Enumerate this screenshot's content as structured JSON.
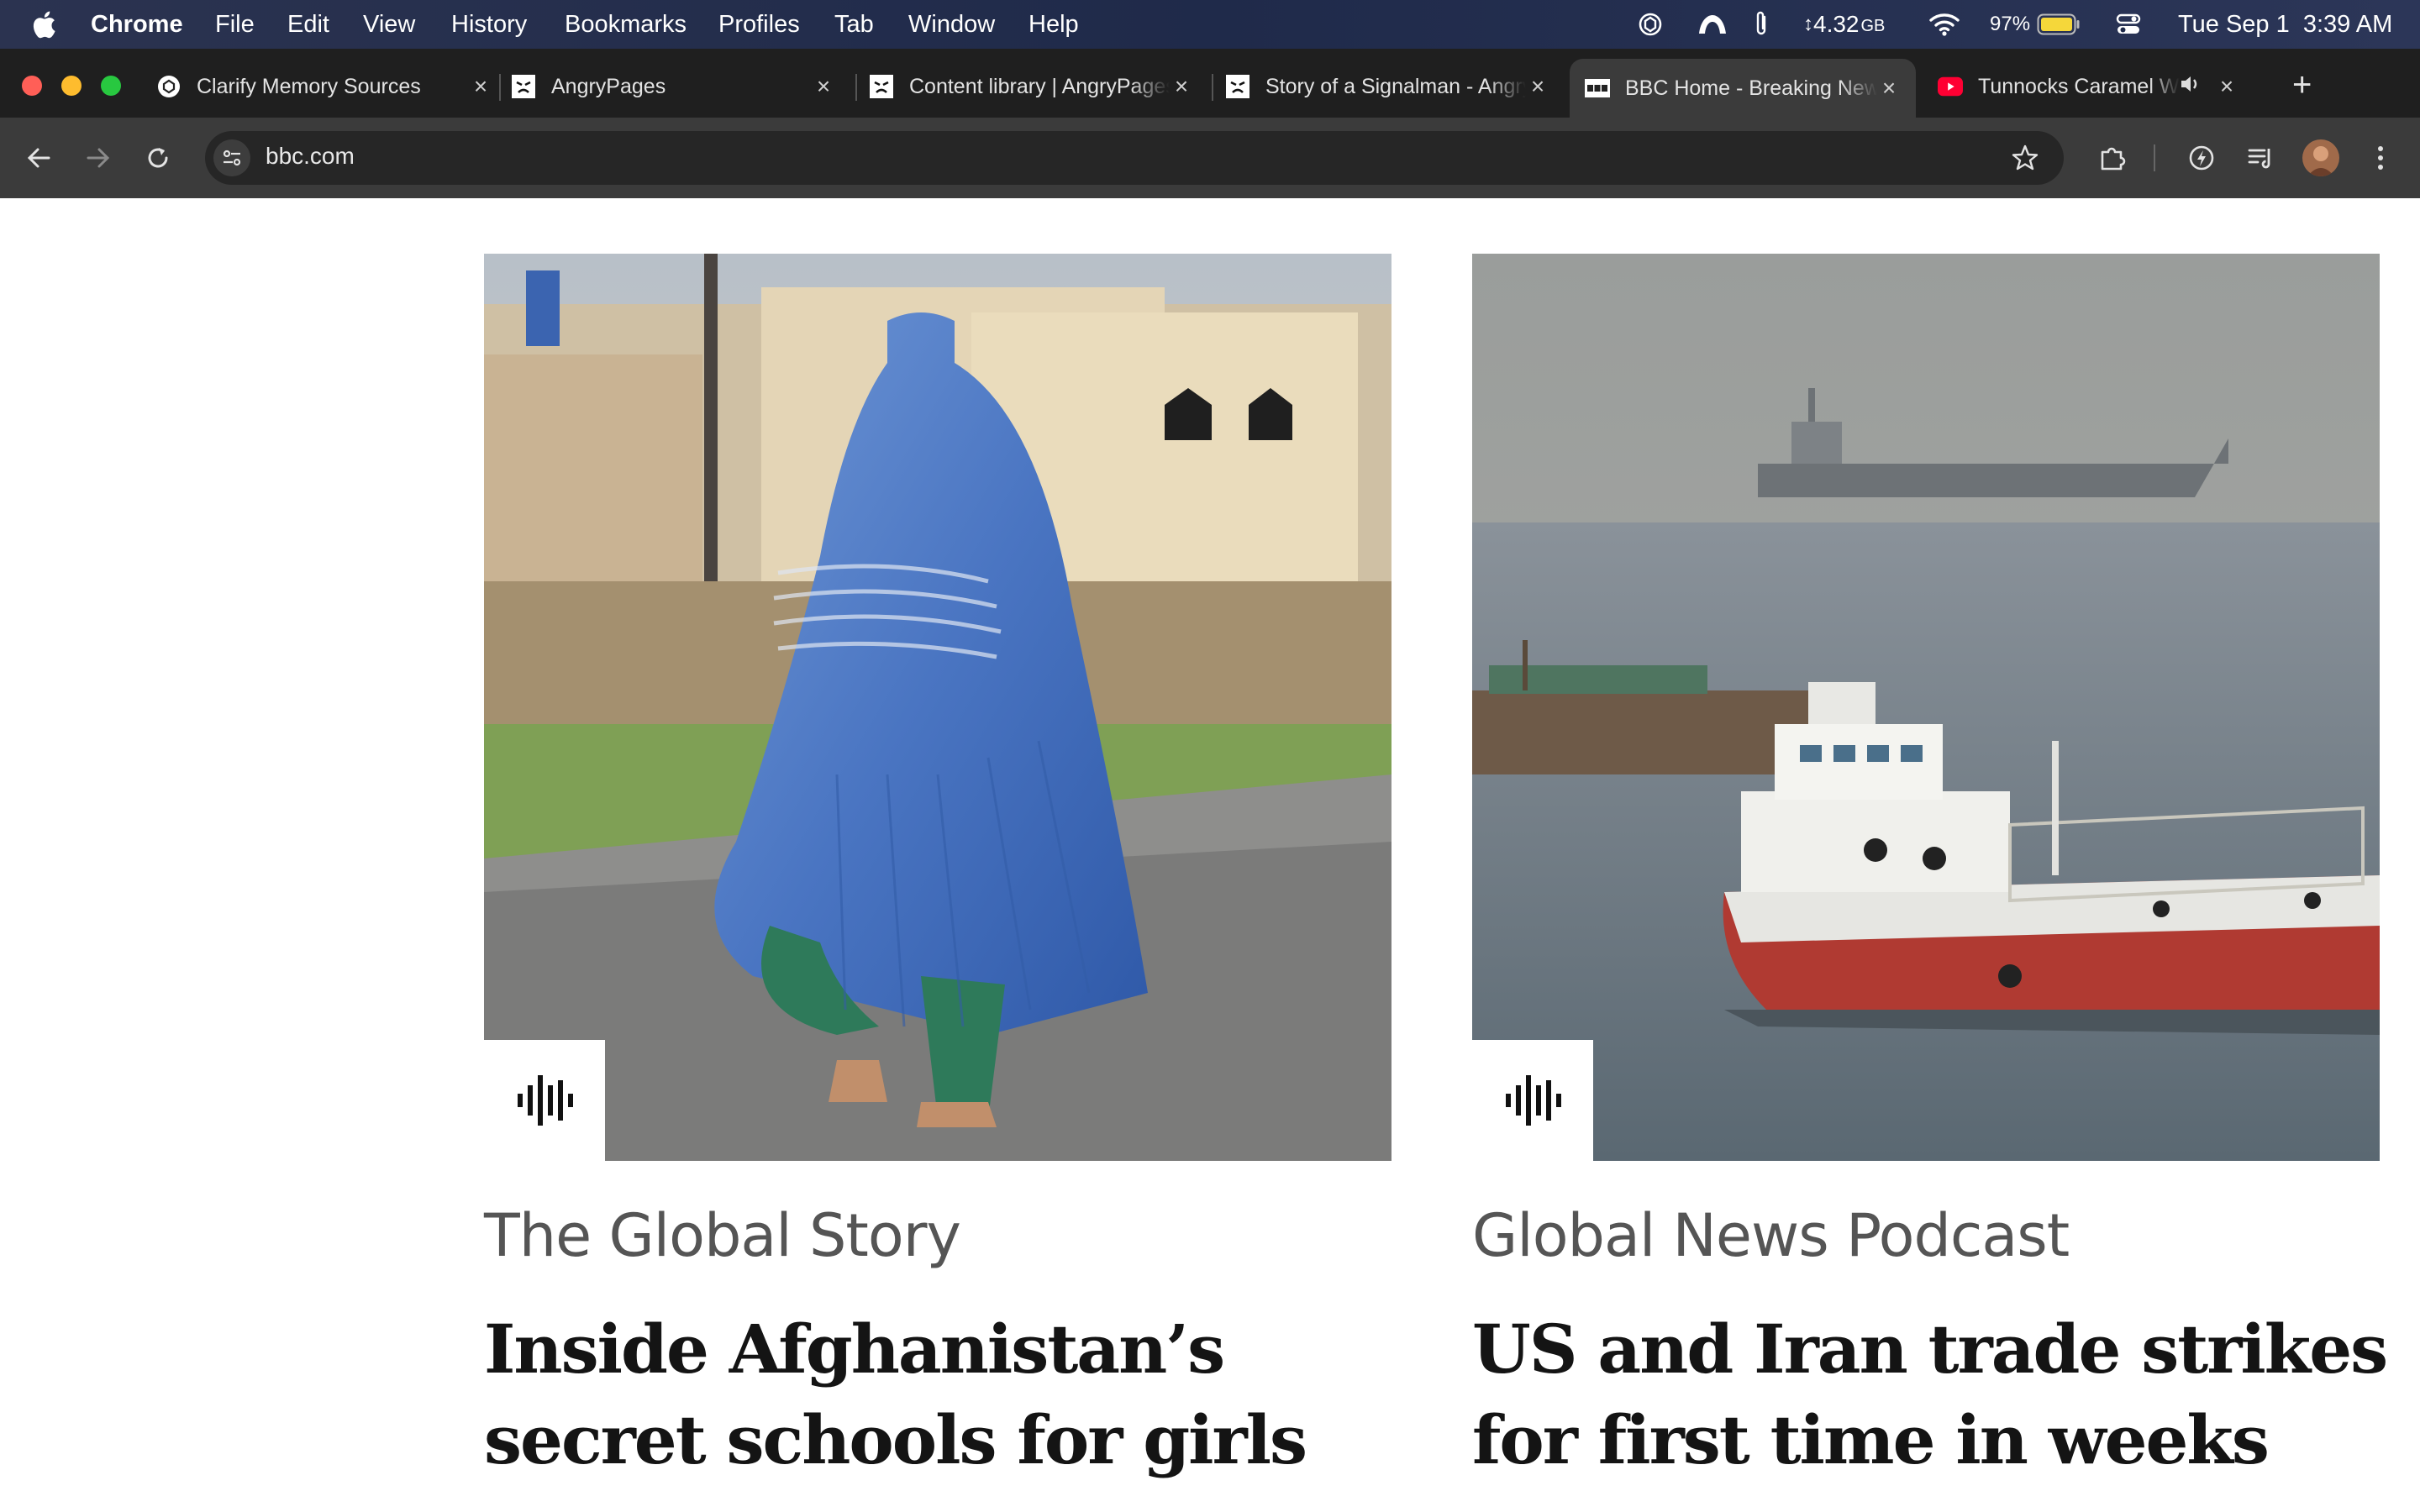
{
  "menubar": {
    "app_name": "Chrome",
    "items": [
      "File",
      "Edit",
      "View",
      "History",
      "Bookmarks",
      "Profiles",
      "Tab",
      "Window",
      "Help"
    ],
    "memory": "4.32",
    "memory_unit": "GB",
    "battery": "97%",
    "datetime": "Tue Sep 1  3:39 AM"
  },
  "tabs": [
    {
      "title": "Clarify Memory Sources",
      "icon": "openai-icon",
      "active": false
    },
    {
      "title": "AngryPages",
      "icon": "angrypages-icon",
      "active": false
    },
    {
      "title": "Content library | AngryPages",
      "icon": "angrypages-icon",
      "active": false
    },
    {
      "title": "Story of a Signalman - AngryPages",
      "icon": "angrypages-icon",
      "active": false
    },
    {
      "title": "BBC Home - Breaking News",
      "icon": "bbc-icon",
      "active": true
    },
    {
      "title": "Tunnocks Caramel Wafer",
      "icon": "youtube-icon",
      "active": false
    }
  ],
  "toolbar": {
    "url": "bbc.com"
  },
  "cards": [
    {
      "kicker": "The Global Story",
      "headline": "Inside Afghanistan’s secret schools for girls",
      "image": "woman-in-blue-burqa-photo"
    },
    {
      "kicker": "Global News Podcast",
      "headline": "US and Iran trade strikes for first time in weeks",
      "image": "ships-at-sea-photo"
    }
  ],
  "colors": {
    "menubar_bg": "#1f2a4a",
    "tabstrip_bg": "#1f1f1f",
    "active_tab_bg": "#3b3b3b",
    "page_bg": "#ffffff",
    "kicker": "#555555",
    "headline": "#141414"
  }
}
